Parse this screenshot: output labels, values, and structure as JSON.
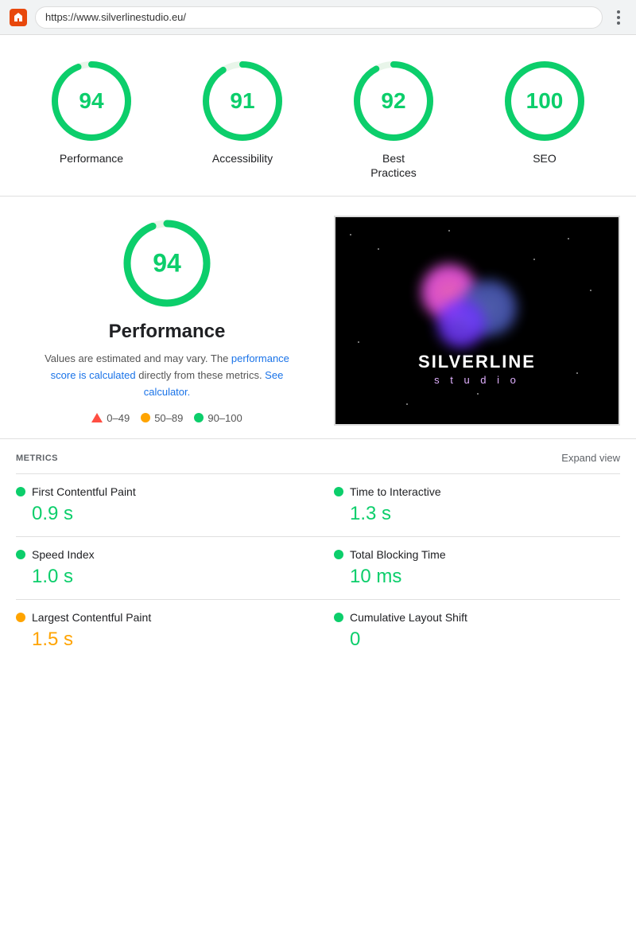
{
  "browser": {
    "url": "https://www.silverlinestudio.eu/",
    "menu_dots": "⋮"
  },
  "scores": [
    {
      "id": "performance",
      "value": 94,
      "label": "Performance",
      "color": "#0cce6b",
      "pct": 94
    },
    {
      "id": "accessibility",
      "value": 91,
      "label": "Accessibility",
      "color": "#0cce6b",
      "pct": 91
    },
    {
      "id": "best-practices",
      "value": 92,
      "label": "Best\nPractices",
      "label_line1": "Best",
      "label_line2": "Practices",
      "color": "#0cce6b",
      "pct": 92
    },
    {
      "id": "seo",
      "value": 100,
      "label": "SEO",
      "color": "#0cce6b",
      "pct": 100
    }
  ],
  "detail": {
    "score": 94,
    "title": "Performance",
    "description_before_link": "Values are estimated and may vary. The ",
    "link1_text": "performance score is calculated",
    "description_middle": " directly from these metrics. ",
    "link2_text": "See calculator.",
    "legend": [
      {
        "id": "fail",
        "type": "triangle",
        "range": "0–49",
        "color": "#ff4e42"
      },
      {
        "id": "average",
        "type": "dot",
        "range": "50–89",
        "color": "#ffa400"
      },
      {
        "id": "pass",
        "type": "dot",
        "range": "90–100",
        "color": "#0cce6b"
      }
    ]
  },
  "metrics": {
    "title": "METRICS",
    "expand_label": "Expand view",
    "items": [
      {
        "id": "fcp",
        "name": "First Contentful Paint",
        "value": "0.9 s",
        "dot_color": "green",
        "value_color": "green"
      },
      {
        "id": "tti",
        "name": "Time to Interactive",
        "value": "1.3 s",
        "dot_color": "green",
        "value_color": "green"
      },
      {
        "id": "si",
        "name": "Speed Index",
        "value": "1.0 s",
        "dot_color": "green",
        "value_color": "green"
      },
      {
        "id": "tbt",
        "name": "Total Blocking Time",
        "value": "10 ms",
        "dot_color": "green",
        "value_color": "green"
      },
      {
        "id": "lcp",
        "name": "Largest Contentful Paint",
        "value": "1.5 s",
        "dot_color": "orange",
        "value_color": "orange"
      },
      {
        "id": "cls",
        "name": "Cumulative Layout Shift",
        "value": "0",
        "dot_color": "green",
        "value_color": "green"
      }
    ]
  }
}
